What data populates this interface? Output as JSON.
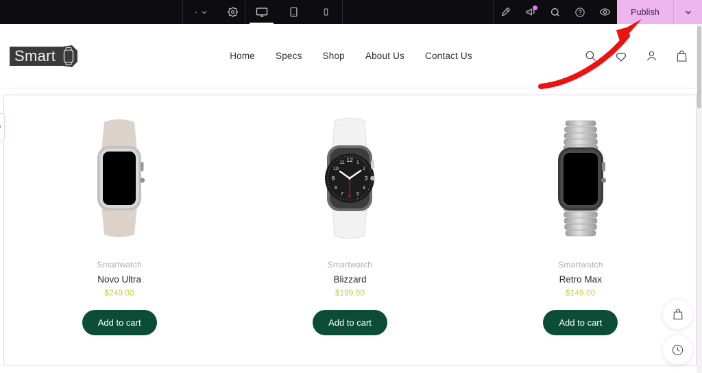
{
  "editor_toolbar": {
    "menu_chevron_icon": "chevron-down-icon",
    "settings_icon": "gear-icon",
    "devices": [
      {
        "name": "desktop",
        "icon": "desktop-icon",
        "active": true
      },
      {
        "name": "tablet",
        "icon": "tablet-icon",
        "active": false
      },
      {
        "name": "mobile",
        "icon": "mobile-icon",
        "active": false
      }
    ],
    "tools": [
      {
        "name": "design-pen",
        "icon": "pen-icon",
        "badge": false
      },
      {
        "name": "announcements",
        "icon": "megaphone-icon",
        "badge": true
      },
      {
        "name": "search",
        "icon": "search-icon",
        "badge": false
      },
      {
        "name": "help",
        "icon": "help-circle-icon",
        "badge": false
      },
      {
        "name": "preview",
        "icon": "eye-icon",
        "badge": false
      }
    ],
    "publish_label": "Publish",
    "publish_chevron_icon": "chevron-down-icon",
    "publish_bg_color": "#eeb6ee",
    "publish_text_color": "#3b2040",
    "bar_bg_color": "#0d0d11",
    "notification_dot_color": "#e879f9"
  },
  "site_header": {
    "logo_text": "Smart",
    "logo_icon": "smartwatch-icon",
    "nav": [
      {
        "label": "Home"
      },
      {
        "label": "Specs"
      },
      {
        "label": "Shop"
      },
      {
        "label": "About Us"
      },
      {
        "label": "Contact Us"
      }
    ],
    "icons": [
      {
        "name": "search-icon"
      },
      {
        "name": "heart-icon"
      },
      {
        "name": "user-icon"
      },
      {
        "name": "shopping-bag-icon"
      }
    ]
  },
  "section": {
    "selected_border_color": "#f0cdf0",
    "collapse_handle_icon": "chevron-left-icon",
    "products": [
      {
        "category": "Smartwatch",
        "title": "Novo Ultra",
        "price": "$249.00",
        "button_label": "Add to cart",
        "image_alt": "smartwatch-beige-sport-band",
        "band_color": "#ddd2c9",
        "case_color": "#b9b9b9",
        "screen_color": "#000000"
      },
      {
        "category": "Smartwatch",
        "title": "Blizzard",
        "price": "$199.00",
        "button_label": "Add to cart",
        "image_alt": "smartwatch-white-band-analog-face",
        "band_color": "#f2f2f2",
        "case_color": "#6d6d6d",
        "screen_color": "#1a1a1a"
      },
      {
        "category": "Smartwatch",
        "title": "Retro Max",
        "price": "$149.00",
        "button_label": "Add to cart",
        "image_alt": "smartwatch-silver-link-bracelet",
        "band_color": "#c3c3c3",
        "case_color": "#3a3a3a",
        "screen_color": "#000000"
      }
    ],
    "button_color": "#0b4d37",
    "price_color": "#c8c84d",
    "category_color": "#adadad"
  },
  "floating_widgets": [
    {
      "name": "cart-widget",
      "icon": "shopping-bag-icon"
    },
    {
      "name": "recent-widget",
      "icon": "clock-icon"
    }
  ],
  "annotation": {
    "arrow_color": "#ee1111",
    "points_to": "Publish"
  }
}
